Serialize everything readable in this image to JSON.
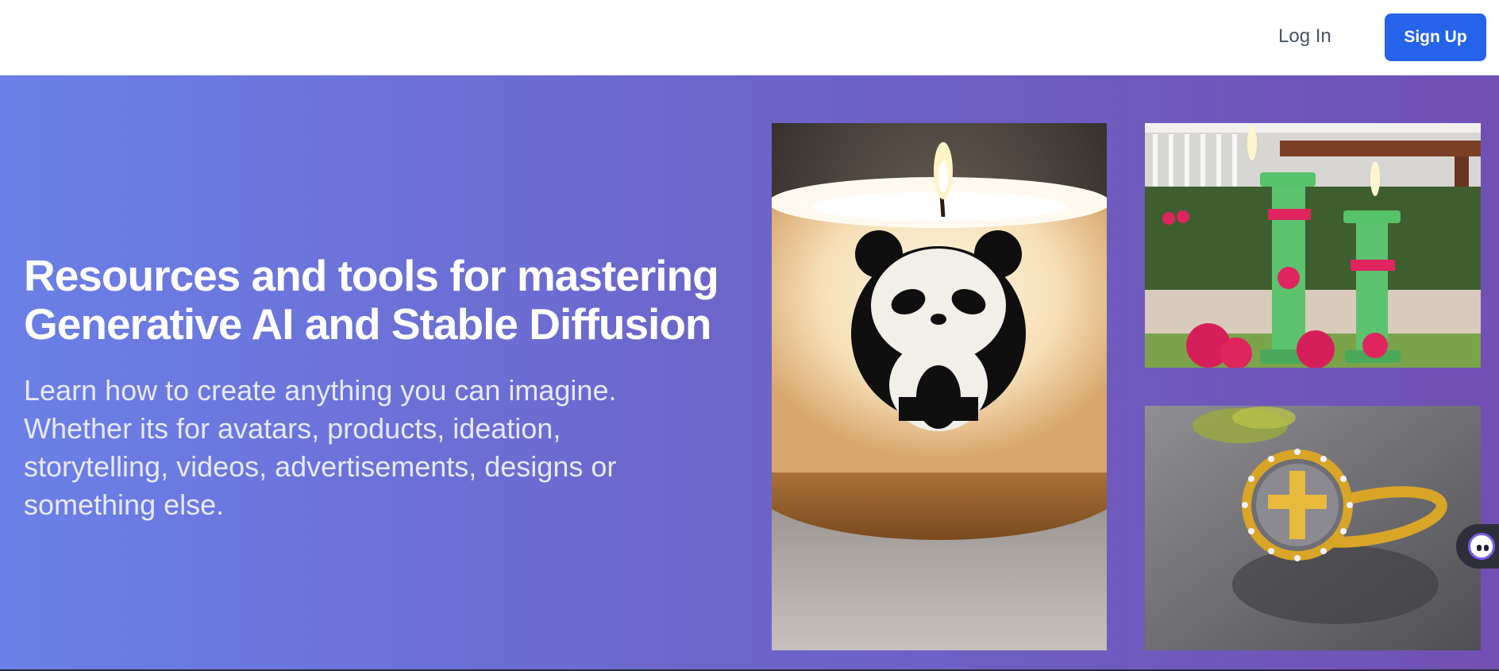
{
  "header": {
    "login_label": "Log In",
    "signup_label": "Sign Up"
  },
  "hero": {
    "title_line1": "Resources and tools for mastering",
    "title_line2": "Generative AI and Stable Diffusion",
    "subtitle": "Learn how to create anything you can imagine. Whether its for avatars, products, ideation, storytelling, videos, advertisements, designs or something else.",
    "gradient_start": "#6b80e8",
    "gradient_end": "#7150b3"
  },
  "gallery": {
    "images": [
      {
        "subject": "panda-candle-image"
      },
      {
        "subject": "green-pillar-candles-image"
      },
      {
        "subject": "cross-ring-image"
      }
    ]
  },
  "chat": {
    "icon": "chat-assistant-icon"
  },
  "colors": {
    "accent": "#2563eb",
    "link": "#4b5563"
  }
}
